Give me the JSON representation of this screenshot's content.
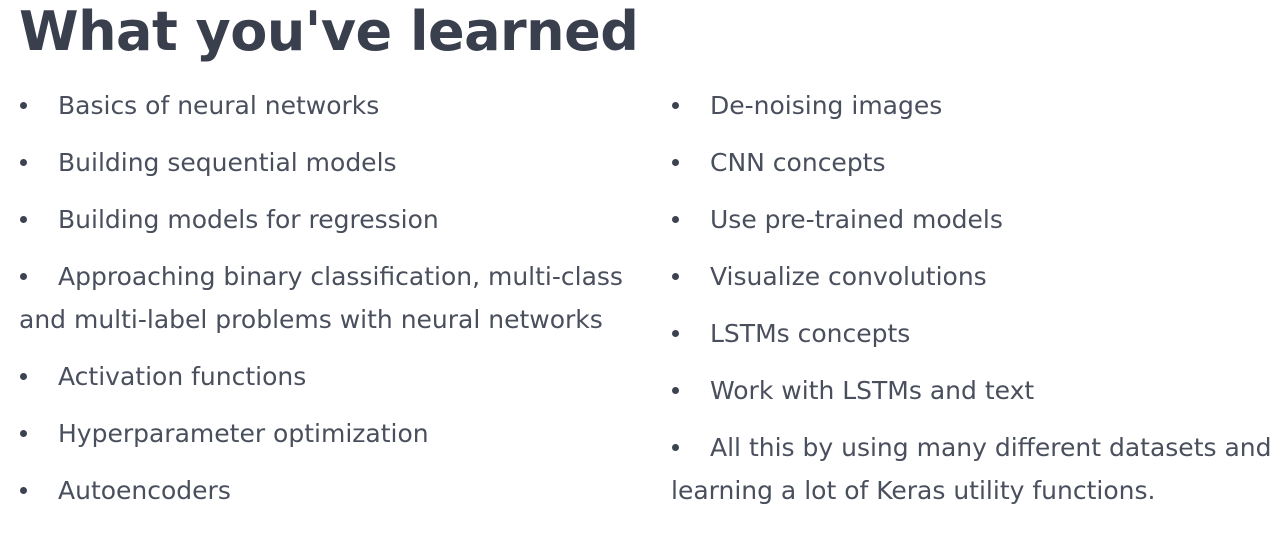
{
  "title": "What you've learned",
  "left_items": [
    "Basics of neural networks",
    "Building sequential models",
    "Building models for regression",
    "Approaching binary classification, multi-class and multi-label problems with neural networks",
    "Activation functions",
    "Hyperparameter optimization",
    "Autoencoders"
  ],
  "right_items": [
    "De-noising images",
    "CNN concepts",
    "Use pre-trained models",
    "Visualize convolutions",
    "LSTMs concepts",
    "Work with LSTMs and text",
    "All this by using many different datasets and learning a lot of Keras utility functions."
  ]
}
